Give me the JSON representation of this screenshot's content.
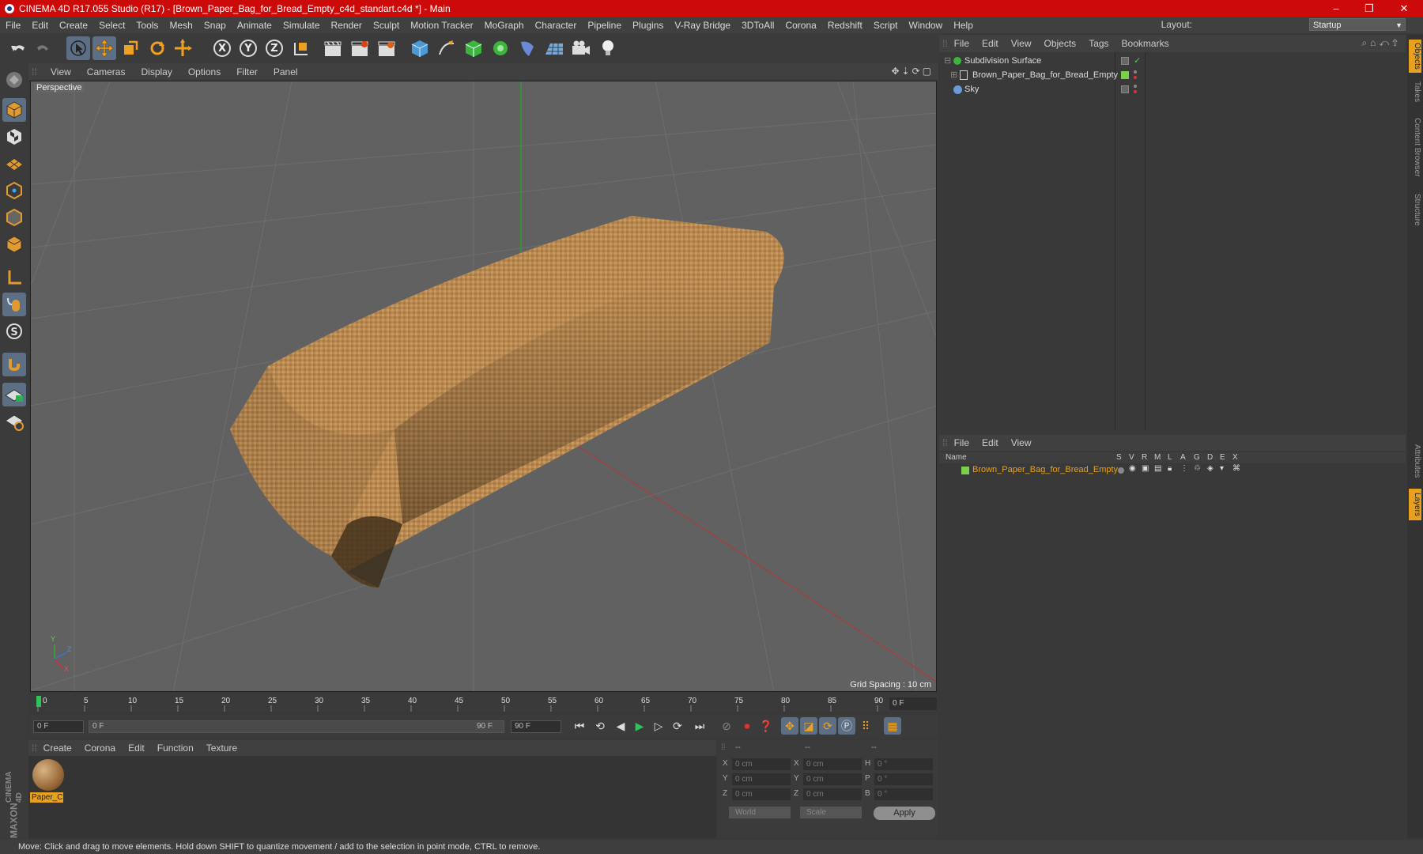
{
  "window": {
    "title": "CINEMA 4D R17.055 Studio (R17) - [Brown_Paper_Bag_for_Bread_Empty_c4d_standart.c4d *] - Main",
    "minimize": "–",
    "maximize": "❐",
    "close": "✕"
  },
  "menubar": {
    "items": [
      "File",
      "Edit",
      "Create",
      "Select",
      "Tools",
      "Mesh",
      "Snap",
      "Animate",
      "Simulate",
      "Render",
      "Sculpt",
      "Motion Tracker",
      "MoGraph",
      "Character",
      "Pipeline",
      "Plugins",
      "V-Ray Bridge",
      "3DToAll",
      "Corona",
      "Redshift",
      "Script",
      "Window",
      "Help"
    ],
    "layout_label": "Layout:",
    "layout_value": "Startup"
  },
  "toolbar": {
    "axis_x": "X",
    "axis_y": "Y",
    "axis_z": "Z"
  },
  "viewport": {
    "menu": [
      "View",
      "Cameras",
      "Display",
      "Options",
      "Filter",
      "Panel"
    ],
    "label": "Perspective",
    "grid_spacing": "Grid Spacing : 10 cm",
    "axis_y": "Y",
    "axis_z": "Z",
    "axis_x": "X"
  },
  "timeline": {
    "ticks": [
      "0",
      "5",
      "10",
      "15",
      "20",
      "25",
      "30",
      "35",
      "40",
      "45",
      "50",
      "55",
      "60",
      "65",
      "70",
      "75",
      "80",
      "85",
      "90"
    ],
    "current_frame": "0 F",
    "start_field": "0 F",
    "range_start": "0 F",
    "range_end": "90 F",
    "end_field": "90 F"
  },
  "material_manager": {
    "menu": [
      "Create",
      "Corona",
      "Edit",
      "Function",
      "Texture"
    ],
    "material_name": "Paper_C"
  },
  "coordinates": {
    "headers": [
      "--",
      "--",
      "--"
    ],
    "rows": [
      {
        "a": "X",
        "av": "0 cm",
        "b": "X",
        "bv": "0 cm",
        "c": "H",
        "cv": "0 °"
      },
      {
        "a": "Y",
        "av": "0 cm",
        "b": "Y",
        "bv": "0 cm",
        "c": "P",
        "cv": "0 °"
      },
      {
        "a": "Z",
        "av": "0 cm",
        "b": "Z",
        "bv": "0 cm",
        "c": "B",
        "cv": "0 °"
      }
    ],
    "world": "World",
    "scale": "Scale",
    "apply": "Apply"
  },
  "object_manager": {
    "menu": [
      "File",
      "Edit",
      "View",
      "Objects",
      "Tags",
      "Bookmarks"
    ],
    "objects": [
      {
        "name": "Subdivision Surface"
      },
      {
        "name": "Brown_Paper_Bag_for_Bread_Empty"
      },
      {
        "name": "Sky"
      }
    ]
  },
  "layer_manager": {
    "menu": [
      "File",
      "Edit",
      "View"
    ],
    "header_name": "Name",
    "columns": [
      "S",
      "V",
      "R",
      "M",
      "L",
      "A",
      "G",
      "D",
      "E",
      "X"
    ],
    "row_name": "Brown_Paper_Bag_for_Bread_Empty"
  },
  "right_tabs": [
    "Objects",
    "Takes",
    "Content Browser",
    "Structure",
    "Attributes",
    "Layers"
  ],
  "status": "Move: Click and drag to move elements. Hold down SHIFT to quantize movement / add to the selection in point mode, CTRL to remove.",
  "logo": {
    "line1": "MAXON",
    "line2": "CINEMA 4D"
  },
  "colors": {
    "accent": "#cc0a0a",
    "selected_tool": "#5c6f85",
    "material_label": "#e8a11f",
    "layer_row": "#e8a11f"
  }
}
